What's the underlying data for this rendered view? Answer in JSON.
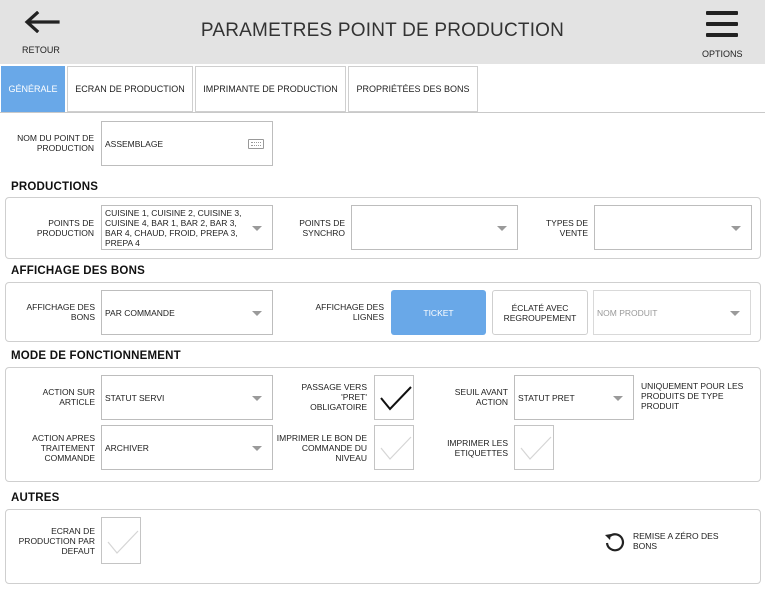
{
  "header": {
    "title": "PARAMETRES POINT DE PRODUCTION",
    "back_label": "RETOUR",
    "options_label": "OPTIONS",
    "icons": [
      "arrow-left-icon",
      "menu-icon"
    ]
  },
  "tabs": [
    {
      "label": "GÉNÉRALE",
      "active": true
    },
    {
      "label": "ECRAN DE PRODUCTION",
      "active": false
    },
    {
      "label": "IMPRIMANTE DE PRODUCTION",
      "active": false
    },
    {
      "label": "PROPRIÉTÉES DES BONS",
      "active": false
    }
  ],
  "general": {
    "name_label": "NOM DU POINT DE PRODUCTION",
    "name_value": "ASSEMBLAGE"
  },
  "productions": {
    "title": "PRODUCTIONS",
    "points_label": "POINTS DE PRODUCTION",
    "points_value": "CUISINE 1, CUISINE 2, CUISINE 3, CUISINE 4, BAR 1, BAR 2, BAR 3, BAR 4, CHAUD, FROID, PREPA 3, PREPA 4",
    "synchro_label": "POINTS DE SYNCHRO",
    "synchro_value": "",
    "types_label": "TYPES DE VENTE",
    "types_value": ""
  },
  "affichage": {
    "title": "AFFICHAGE DES BONS",
    "bons_label": "AFFICHAGE DES BONS",
    "bons_value": "PAR COMMANDE",
    "lignes_label": "AFFICHAGE DES LIGNES",
    "ticket_label": "TICKET",
    "eclate_label": "ÉCLATÉ AVEC REGROUPEMENT",
    "produit_placeholder": "NOM PRODUIT"
  },
  "mode": {
    "title": "MODE DE FONCTIONNEMENT",
    "action_article_label": "ACTION SUR ARTICLE",
    "action_article_value": "STATUT SERVI",
    "passage_label": "PASSAGE VERS 'PRET' OBLIGATOIRE",
    "passage_checked": true,
    "seuil_label": "SEUIL AVANT ACTION",
    "seuil_value": "STATUT PRET",
    "seuil_note": "UNIQUEMENT POUR LES PRODUITS DE TYPE PRODUIT",
    "action_apres_label": "ACTION APRES TRAITEMENT COMMANDE",
    "action_apres_value": "ARCHIVER",
    "imprimer_bon_label": "IMPRIMER LE BON DE COMMANDE DU NIVEAU",
    "imprimer_bon_checked": false,
    "imprimer_etiq_label": "IMPRIMER LES ETIQUETTES",
    "imprimer_etiq_checked": false
  },
  "autres": {
    "title": "AUTRES",
    "ecran_defaut_label": "ECRAN DE PRODUCTION PAR DEFAUT",
    "ecran_defaut_checked": false,
    "reset_label": "REMISE A ZÉRO DES BONS"
  },
  "colors": {
    "accent": "#69a8e8",
    "header_bg": "#e3e3e3",
    "border": "#cfcfcf"
  }
}
